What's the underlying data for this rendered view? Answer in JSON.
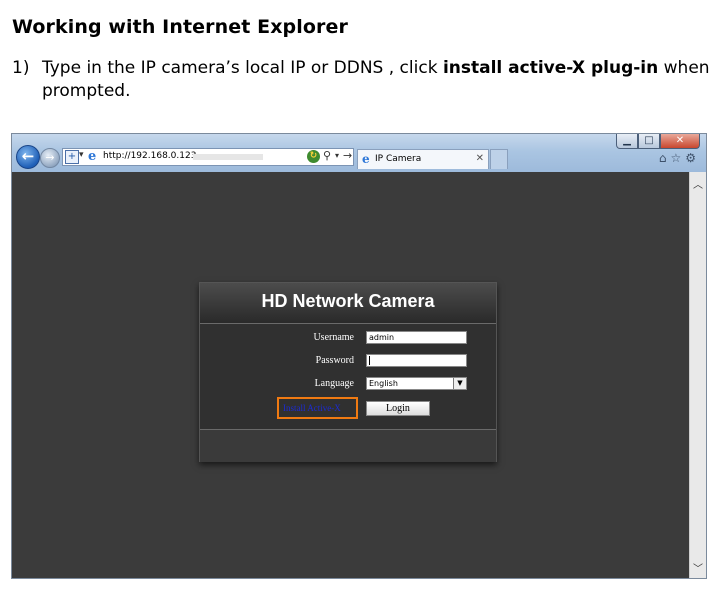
{
  "doc": {
    "heading": "Working with Internet Explorer",
    "step_number": "1)",
    "step_text_before": "Type in the IP camera’s local IP or DDNS , click ",
    "step_text_bold": "install active-X plug-in",
    "step_text_after": " when prompted."
  },
  "browser": {
    "url": "http://192.168.0.123",
    "tab_label": "IP Camera",
    "window_buttons": {
      "minimize": "▁",
      "maximize": "□",
      "close": "✕"
    },
    "icons": [
      "back-arrow-icon",
      "forward-arrow-icon",
      "search-icon",
      "home-icon",
      "star-icon",
      "gear-icon"
    ]
  },
  "login": {
    "title": "HD Network Camera",
    "username_label": "Username",
    "username_value": "admin",
    "password_label": "Password",
    "language_label": "Language",
    "language_value": "English",
    "activex_link": "Install Active-X",
    "login_button": "Login"
  },
  "colors": {
    "highlight_border": "#f07a12",
    "link": "#1b2bd4",
    "panel_bg": "#303030"
  }
}
